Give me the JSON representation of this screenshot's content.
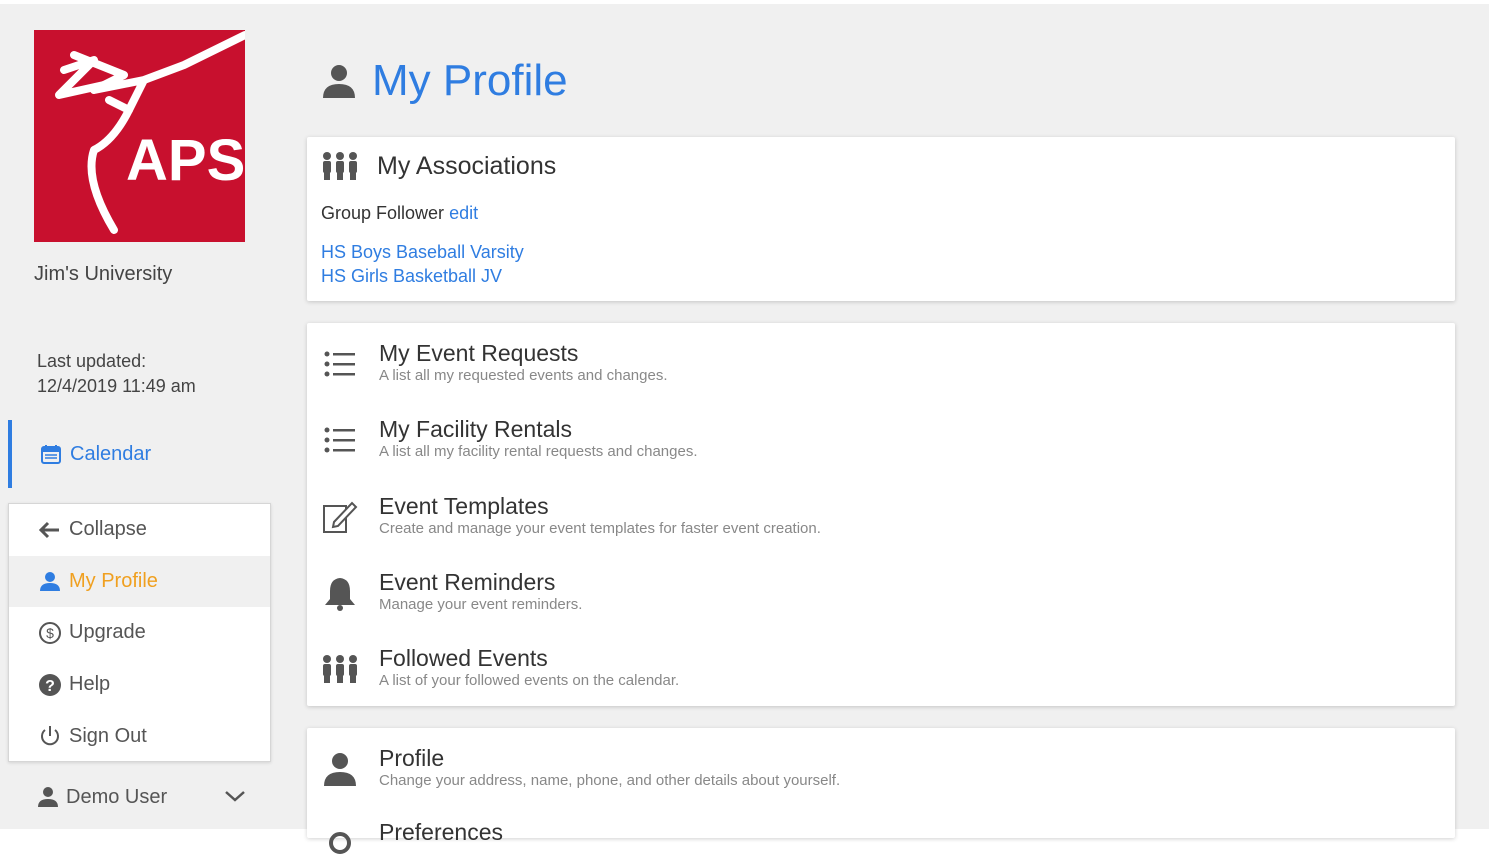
{
  "sidebar": {
    "logo_text": "APS",
    "university": "Jim's University",
    "last_updated_label": "Last updated:",
    "last_updated_value": "12/4/2019 11:49 am",
    "calendar_label": "Calendar",
    "menu": [
      {
        "label": "Collapse",
        "icon": "arrow-left-icon"
      },
      {
        "label": "My Profile",
        "icon": "user-icon",
        "active": true
      },
      {
        "label": "Upgrade",
        "icon": "dollar-circle-icon"
      },
      {
        "label": "Help",
        "icon": "question-circle-icon"
      },
      {
        "label": "Sign Out",
        "icon": "power-icon"
      }
    ],
    "user_name": "Demo User"
  },
  "main": {
    "title": "My Profile",
    "associations": {
      "title": "My Associations",
      "group_follower_label": "Group Follower",
      "edit_label": "edit",
      "teams": [
        "HS Boys Baseball Varsity",
        "HS Girls Basketball JV"
      ]
    },
    "rows": [
      {
        "title": "My Event Requests",
        "subtitle": "A list all my requested events and changes.",
        "icon": "list-icon"
      },
      {
        "title": "My Facility Rentals",
        "subtitle": "A list all my facility rental requests and changes.",
        "icon": "list-icon"
      },
      {
        "title": "Event Templates",
        "subtitle": "Create and manage your event templates for faster event creation.",
        "icon": "edit-icon"
      },
      {
        "title": "Event Reminders",
        "subtitle": "Manage your event reminders.",
        "icon": "bell-icon"
      },
      {
        "title": "Followed Events",
        "subtitle": "A list of your followed events on the calendar.",
        "icon": "people-icon"
      }
    ],
    "profile": {
      "title": "Profile",
      "subtitle": "Change your address, name, phone, and other details about yourself.",
      "next_title": "Preferences"
    }
  },
  "colors": {
    "accent": "#2f7de1",
    "brand": "#c8102e",
    "active": "#f0a020"
  }
}
